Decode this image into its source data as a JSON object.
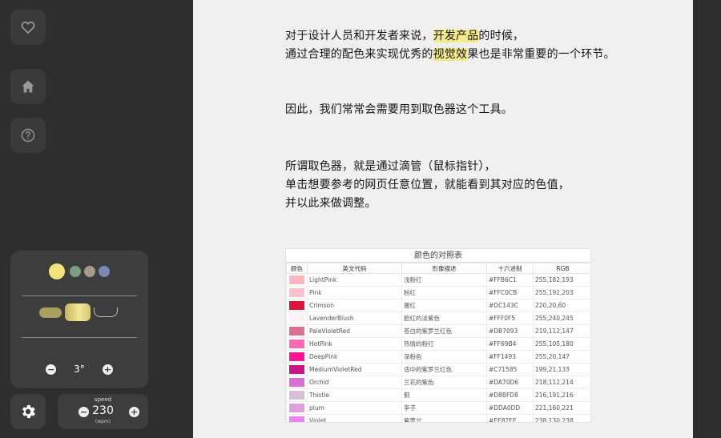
{
  "sidebar": {
    "icons": [
      "heart-icon",
      "home-icon",
      "help-icon"
    ]
  },
  "article": {
    "p1_line1_pre": "对于设计人员和开发者来说，",
    "p1_line1_hl": "开发产品",
    "p1_line1_post": "的时候，",
    "p1_line2_pre": "通过合理的配色来实现优秀的",
    "p1_line2_hl": "视觉效",
    "p1_line2_post": "果也是非常重要的一个环节。",
    "p2": "因此，我们常常会需要用到取色器这个工具。",
    "p3_line1": "所谓取色器，就是通过滴管（鼠标指针），",
    "p3_line2": "单击想要参考的网页任意位置，就能看到其对应的色值，",
    "p3_line3": "并以此来做调整。"
  },
  "color_table": {
    "title": "颜色的对照表",
    "headers": [
      "颜色",
      "英文代码",
      "形像描述",
      "十六进制",
      "RGB"
    ],
    "rows": [
      {
        "swatch": "#FFB6C1",
        "name": "LightPink",
        "desc": "浅粉红",
        "hex": "#FFB6C1",
        "rgb": "255,182,193"
      },
      {
        "swatch": "#FFC0CB",
        "name": "Pink",
        "desc": "粉红",
        "hex": "#FFC0CB",
        "rgb": "255,192,203"
      },
      {
        "swatch": "#DC143C",
        "name": "Crimson",
        "desc": "猩红",
        "hex": "#DC143C",
        "rgb": "220,20,60"
      },
      {
        "swatch": "#FFF0F5",
        "name": "LavenderBlush",
        "desc": "脸红的淡紫色",
        "hex": "#FFF0F5",
        "rgb": "255,240,245"
      },
      {
        "swatch": "#DB7093",
        "name": "PaleVioletRed",
        "desc": "苍白的紫罗兰红色",
        "hex": "#DB7093",
        "rgb": "219,112,147"
      },
      {
        "swatch": "#FF69B4",
        "name": "HotPink",
        "desc": "热情的粉红",
        "hex": "#FF69B4",
        "rgb": "255,105,180"
      },
      {
        "swatch": "#FF1493",
        "name": "DeepPink",
        "desc": "深粉色",
        "hex": "#FF1493",
        "rgb": "255,20,147"
      },
      {
        "swatch": "#C71585",
        "name": "MediumVioletRed",
        "desc": "适中的紫罗兰红色",
        "hex": "#C71585",
        "rgb": "199,21,133"
      },
      {
        "swatch": "#DA70D6",
        "name": "Orchid",
        "desc": "兰花的紫色",
        "hex": "#DA70D6",
        "rgb": "218,112,214"
      },
      {
        "swatch": "#D8BFD8",
        "name": "Thistle",
        "desc": "蓟",
        "hex": "#D8BFD8",
        "rgb": "216,191,216"
      },
      {
        "swatch": "#DDA0DD",
        "name": "plum",
        "desc": "李子",
        "hex": "#DDA0DD",
        "rgb": "221,160,221"
      },
      {
        "swatch": "#EE82EE",
        "name": "Violet",
        "desc": "紫罗兰",
        "hex": "#EE82EE",
        "rgb": "238,130,238"
      },
      {
        "swatch": "#FF00FF",
        "name": "",
        "desc": "",
        "hex": "",
        "rgb": ""
      }
    ]
  },
  "controls": {
    "colors": [
      "#f3e37c",
      "#7aa07e",
      "#a69a8c",
      "#7b87b4"
    ],
    "angle_minus": "−",
    "angle_plus": "+",
    "angle_value": "3°",
    "settings_icon": "gear-icon",
    "speed_title": "speed",
    "speed_value": "230",
    "speed_unit": "(wpm)",
    "speed_minus": "−",
    "speed_plus": "+"
  }
}
